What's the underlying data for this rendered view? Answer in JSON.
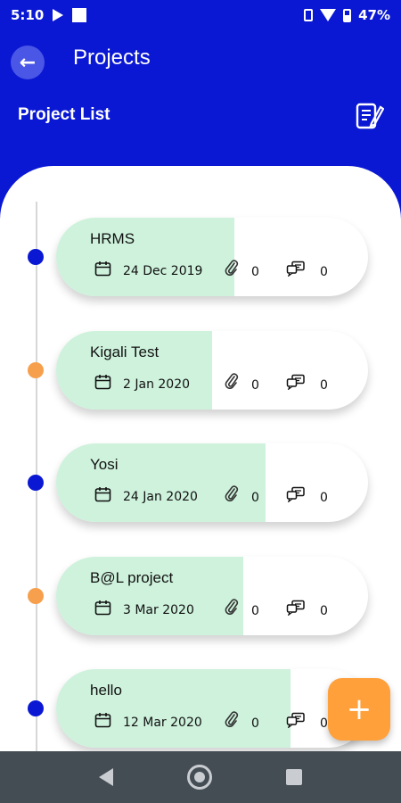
{
  "status_bar": {
    "time": "5:10",
    "battery": "47%",
    "icons": [
      "play-icon",
      "square-notification-icon",
      "vibrate-icon",
      "wifi-icon",
      "battery-icon"
    ]
  },
  "app_bar": {
    "back_icon": "arrow-left-icon",
    "title": "Projects"
  },
  "subheader": {
    "label": "Project List",
    "icon": "document-edit-icon"
  },
  "colors": {
    "primary": "#0a18d3",
    "card_fill": "#cef2dc",
    "dot_blue": "#0a18d3",
    "dot_orange": "#f6a04d",
    "fab": "#ffa03a"
  },
  "projects": [
    {
      "name": "HRMS",
      "date": "24 Dec 2019",
      "attachments": "0",
      "comments": "0",
      "dot_color": "#0a18d3",
      "progress": 0.57
    },
    {
      "name": "Kigali Test",
      "date": "2 Jan 2020",
      "attachments": "0",
      "comments": "0",
      "dot_color": "#f6a04d",
      "progress": 0.5
    },
    {
      "name": "Yosi",
      "date": "24 Jan 2020",
      "attachments": "0",
      "comments": "0",
      "dot_color": "#0a18d3",
      "progress": 0.67
    },
    {
      "name": "B@L project",
      "date": "3 Mar 2020",
      "attachments": "0",
      "comments": "0",
      "dot_color": "#f6a04d",
      "progress": 0.6
    },
    {
      "name": "hello",
      "date": "12 Mar 2020",
      "attachments": "0",
      "comments": "0",
      "dot_color": "#0a18d3",
      "progress": 0.75
    }
  ],
  "fab": {
    "label": "+",
    "icon": "plus-icon"
  },
  "nav_bar": {
    "icons": [
      "back-triangle-icon",
      "home-circle-icon",
      "recents-square-icon"
    ]
  }
}
